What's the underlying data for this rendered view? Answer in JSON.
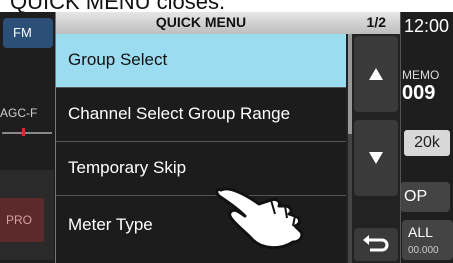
{
  "caption": "QUICK MENU closes.",
  "background": {
    "mode": "FM",
    "agc": "AGC-F",
    "time": "12:00",
    "memo_label": "MEMO",
    "memo_num": "009",
    "freq_step": "20k",
    "op_label": "OP",
    "pro_label": "PRO",
    "all_label": "ALL",
    "all_value": "00.000"
  },
  "quick_menu": {
    "title": "QUICK MENU",
    "page": "1/2",
    "items": [
      {
        "label": "Group Select",
        "selected": true
      },
      {
        "label": "Channel Select Group Range",
        "selected": false
      },
      {
        "label": "Temporary Skip",
        "selected": false
      },
      {
        "label": "Meter Type",
        "selected": false
      }
    ]
  },
  "icons": {
    "up": "up-triangle-icon",
    "down": "down-triangle-icon",
    "back": "return-icon",
    "hand": "pointing-hand-icon"
  }
}
